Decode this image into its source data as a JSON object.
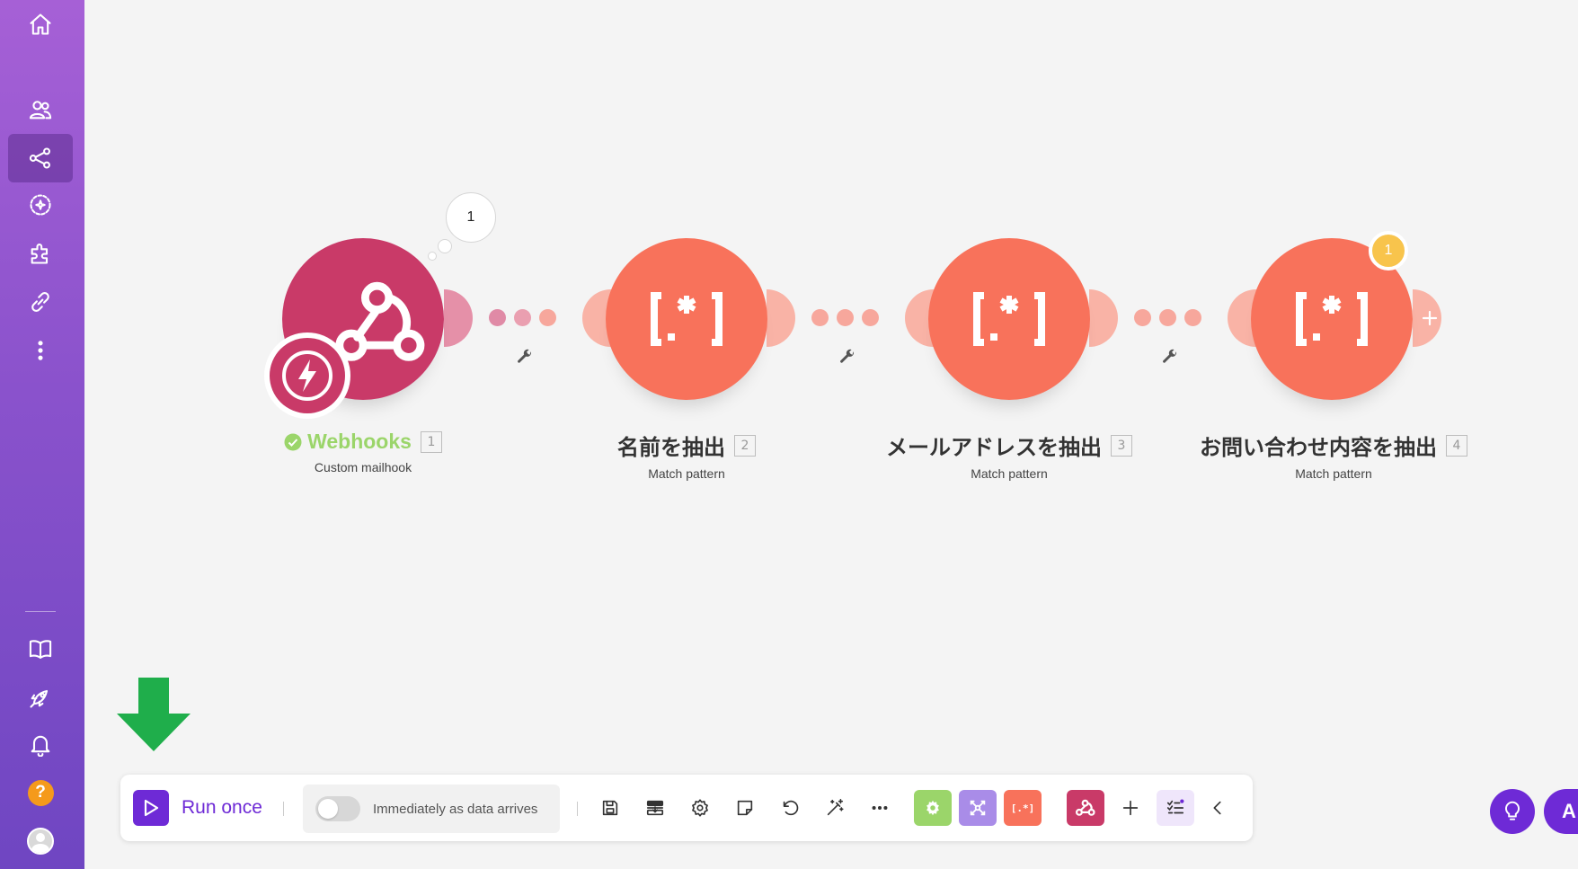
{
  "sidebar": {
    "items": [
      {
        "name": "home-icon"
      },
      {
        "name": "team-icon"
      },
      {
        "name": "scenarios-icon",
        "active": true
      },
      {
        "name": "ai-agents-icon"
      },
      {
        "name": "apps-icon"
      },
      {
        "name": "connections-icon"
      },
      {
        "name": "more-icon"
      }
    ],
    "bottom": [
      {
        "name": "docs-icon"
      },
      {
        "name": "whats-new-icon"
      },
      {
        "name": "notifications-icon"
      },
      {
        "name": "help-icon",
        "label": "?"
      },
      {
        "name": "avatar"
      }
    ]
  },
  "scenario": {
    "modules": [
      {
        "id": "webhook",
        "title": "Webhooks",
        "number": "1",
        "subtitle": "Custom mailhook",
        "color": "#c93a68",
        "status": "success"
      },
      {
        "id": "m2",
        "title": "名前を抽出",
        "number": "2",
        "subtitle": "Match pattern",
        "color": "#f8725b"
      },
      {
        "id": "m3",
        "title": "メールアドレスを抽出",
        "number": "3",
        "subtitle": "Match pattern",
        "color": "#f8725b"
      },
      {
        "id": "m4",
        "title": "お問い合わせ内容を抽出",
        "number": "4",
        "subtitle": "Match pattern",
        "color": "#f8725b"
      }
    ],
    "queue_bubble": "1",
    "operation_badge": "1"
  },
  "toolbar": {
    "run_label": "Run once",
    "schedule_label": "Immediately as data arrives",
    "schedule_enabled": false,
    "icons": [
      "save-icon",
      "explain-flow-icon",
      "settings-icon",
      "notes-icon",
      "undo-icon",
      "auto-align-icon",
      "more-icon"
    ],
    "tiles": [
      {
        "name": "tools-tile",
        "color": "#9bd56a"
      },
      {
        "name": "flow-control-tile",
        "color": "#a98ce8"
      },
      {
        "name": "text-parser-tile",
        "color": "#f8725b",
        "text": "[.*]"
      },
      {
        "name": "webhooks-tile",
        "color": "#c93a68"
      }
    ]
  },
  "fab": {
    "ai_label": "A"
  }
}
